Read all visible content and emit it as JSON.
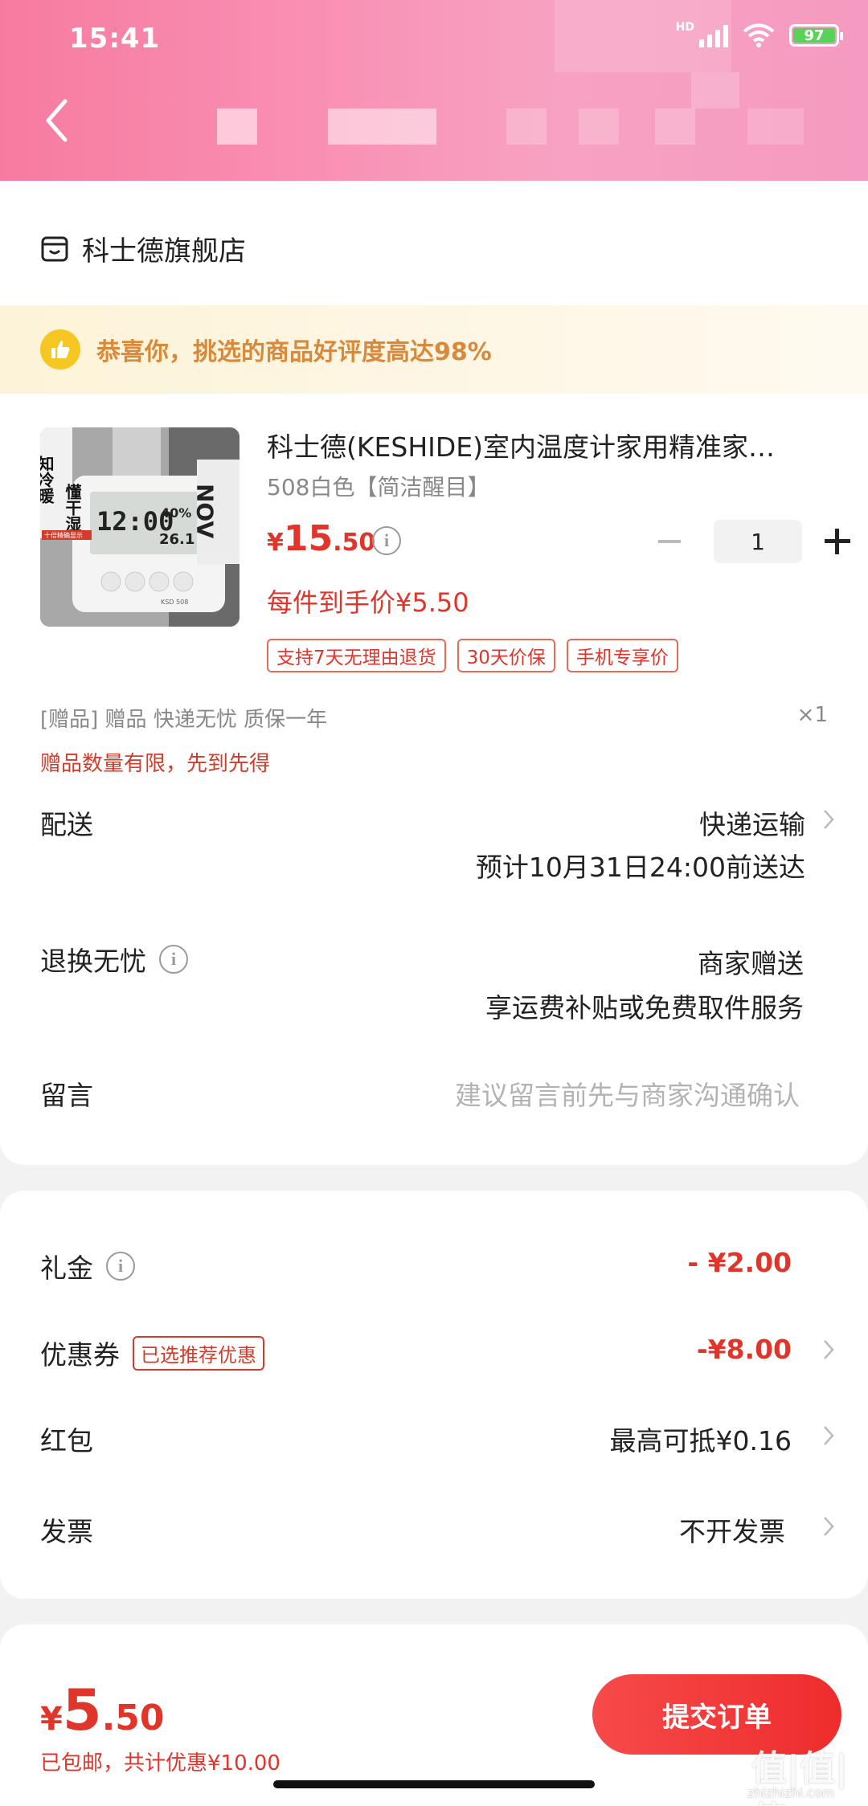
{
  "status_bar": {
    "time": "15:41",
    "network": "HD",
    "battery": "97"
  },
  "store": {
    "name": "科士德旗舰店"
  },
  "banner": {
    "text": "恭喜你，挑选的商品好评度高达98%"
  },
  "product": {
    "title": "科士德(KESHIDE)室内温度计家用精准家…",
    "spec": "508白色【简洁醒目】",
    "price_symbol": "¥",
    "price_int": "15",
    "price_dec": ".50",
    "quantity": "1",
    "per_price": "每件到手价¥5.50",
    "tags": [
      "支持7天无理由退货",
      "30天价保",
      "手机专享价"
    ],
    "image_text": {
      "left_title": "知冷暖",
      "right_title": "懂干湿",
      "clock": "12:00",
      "humidity": "40%",
      "temp": "26.1",
      "badge": "十倍精确显示",
      "model": "KSD 508",
      "side_text": "NOV"
    }
  },
  "gift": {
    "label": "[赠品]  赠品 快递无忧 质保一年",
    "count": "×1",
    "note": "赠品数量有限，先到先得"
  },
  "delivery": {
    "label": "配送",
    "method": "快递运输",
    "eta": "预计10月31日24:00前送达"
  },
  "returns": {
    "label": "退换无忧",
    "value1": "商家赠送",
    "value2": "享运费补贴或免费取件服务"
  },
  "message": {
    "label": "留言",
    "placeholder": "建议留言前先与商家沟通确认"
  },
  "gift_money": {
    "label": "礼金",
    "value": "- ¥2.00"
  },
  "coupon": {
    "label": "优惠券",
    "tag": "已选推荐优惠",
    "value": "-¥8.00"
  },
  "red_packet": {
    "label": "红包",
    "value": "最高可抵¥0.16"
  },
  "invoice": {
    "label": "发票",
    "value": "不开发票"
  },
  "bottom": {
    "symbol": "¥",
    "int": "5",
    "dec": ".50",
    "sub": "已包邮，共计优惠¥10.00",
    "submit": "提交订单"
  },
  "watermark": {
    "main": "值|值|值",
    "sub": "zhizhizhi.com"
  },
  "colors": {
    "accent": "#e0352b",
    "header_pink": "#f98fb3",
    "banner_text": "#d9893a"
  }
}
